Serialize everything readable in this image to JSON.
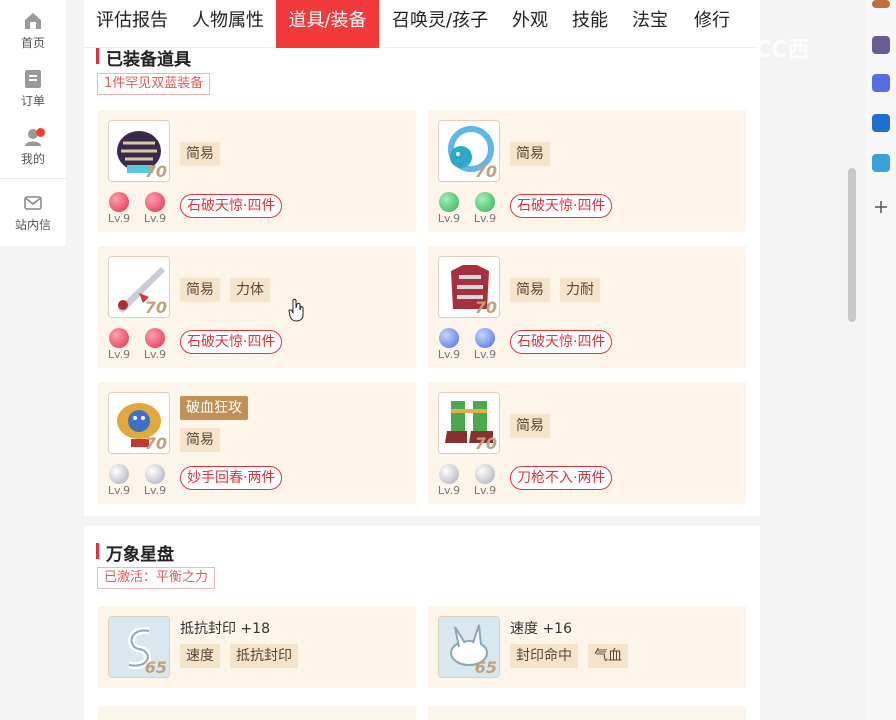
{
  "sidebar": {
    "items": [
      {
        "label": "首页",
        "icon": "home-icon"
      },
      {
        "label": "订单",
        "icon": "order-icon"
      },
      {
        "label": "我的",
        "icon": "user-icon"
      },
      {
        "label": "站内信",
        "icon": "mail-icon"
      }
    ]
  },
  "tabs": [
    "评估报告",
    "人物属性",
    "道具/装备",
    "召唤灵/孩子",
    "外观",
    "技能",
    "法宝",
    "修行"
  ],
  "active_tab": "道具/装备",
  "equipped": {
    "title": "已装备道具",
    "badge": "1件罕见双蓝装备",
    "items": [
      {
        "level": "70",
        "icon": "helmet-icon",
        "chips": [
          "简易"
        ],
        "gems": [
          {
            "level": "Lv.9",
            "color": "#e0304a"
          },
          {
            "level": "Lv.9",
            "color": "#e0304a"
          }
        ],
        "set": "石破天惊·四件"
      },
      {
        "level": "70",
        "icon": "necklace-icon",
        "chips": [
          "简易"
        ],
        "gems": [
          {
            "level": "Lv.9",
            "color": "#2fae56"
          },
          {
            "level": "Lv.9",
            "color": "#2fae56"
          }
        ],
        "set": "石破天惊·四件"
      },
      {
        "level": "70",
        "icon": "weapon-icon",
        "chips": [
          "简易",
          "力体"
        ],
        "gems": [
          {
            "level": "Lv.9",
            "color": "#e0304a"
          },
          {
            "level": "Lv.9",
            "color": "#e0304a"
          }
        ],
        "set": "石破天惊·四件"
      },
      {
        "level": "70",
        "icon": "armor-icon",
        "chips": [
          "简易",
          "力耐"
        ],
        "gems": [
          {
            "level": "Lv.9",
            "color": "#4a6be0"
          },
          {
            "level": "Lv.9",
            "color": "#4a6be0"
          }
        ],
        "set": "石破天惊·四件"
      },
      {
        "level": "70",
        "icon": "belt-icon",
        "chips": [
          "破血狂攻",
          "简易"
        ],
        "gems": [
          {
            "level": "Lv.9",
            "color": "#c9c9d3"
          },
          {
            "level": "Lv.9",
            "color": "#c9c9d3"
          }
        ],
        "set": "妙手回春·两件"
      },
      {
        "level": "70",
        "icon": "boots-icon",
        "chips": [
          "简易"
        ],
        "gems": [
          {
            "level": "Lv.9",
            "color": "#c9c9d3"
          },
          {
            "level": "Lv.9",
            "color": "#c9c9d3"
          }
        ],
        "set": "刀枪不入·两件"
      }
    ]
  },
  "starboard": {
    "title": "万象星盘",
    "badge": "已激活：平衡之力",
    "items": [
      {
        "level": "65",
        "icon": "star-rune-icon",
        "attr": "抵抗封印 +18",
        "chips": [
          "速度",
          "抵抗封印"
        ]
      },
      {
        "level": "65",
        "icon": "star-rune-icon",
        "attr": "速度 +16",
        "chips": [
          "封印命中",
          "气血"
        ]
      }
    ]
  },
  "watermark": "CC西",
  "colors": {
    "accent": "#f23a3a",
    "card_bg": "#fdf4ea",
    "chip_bg": "#f5e3cc",
    "set_red": "#e0343b"
  }
}
